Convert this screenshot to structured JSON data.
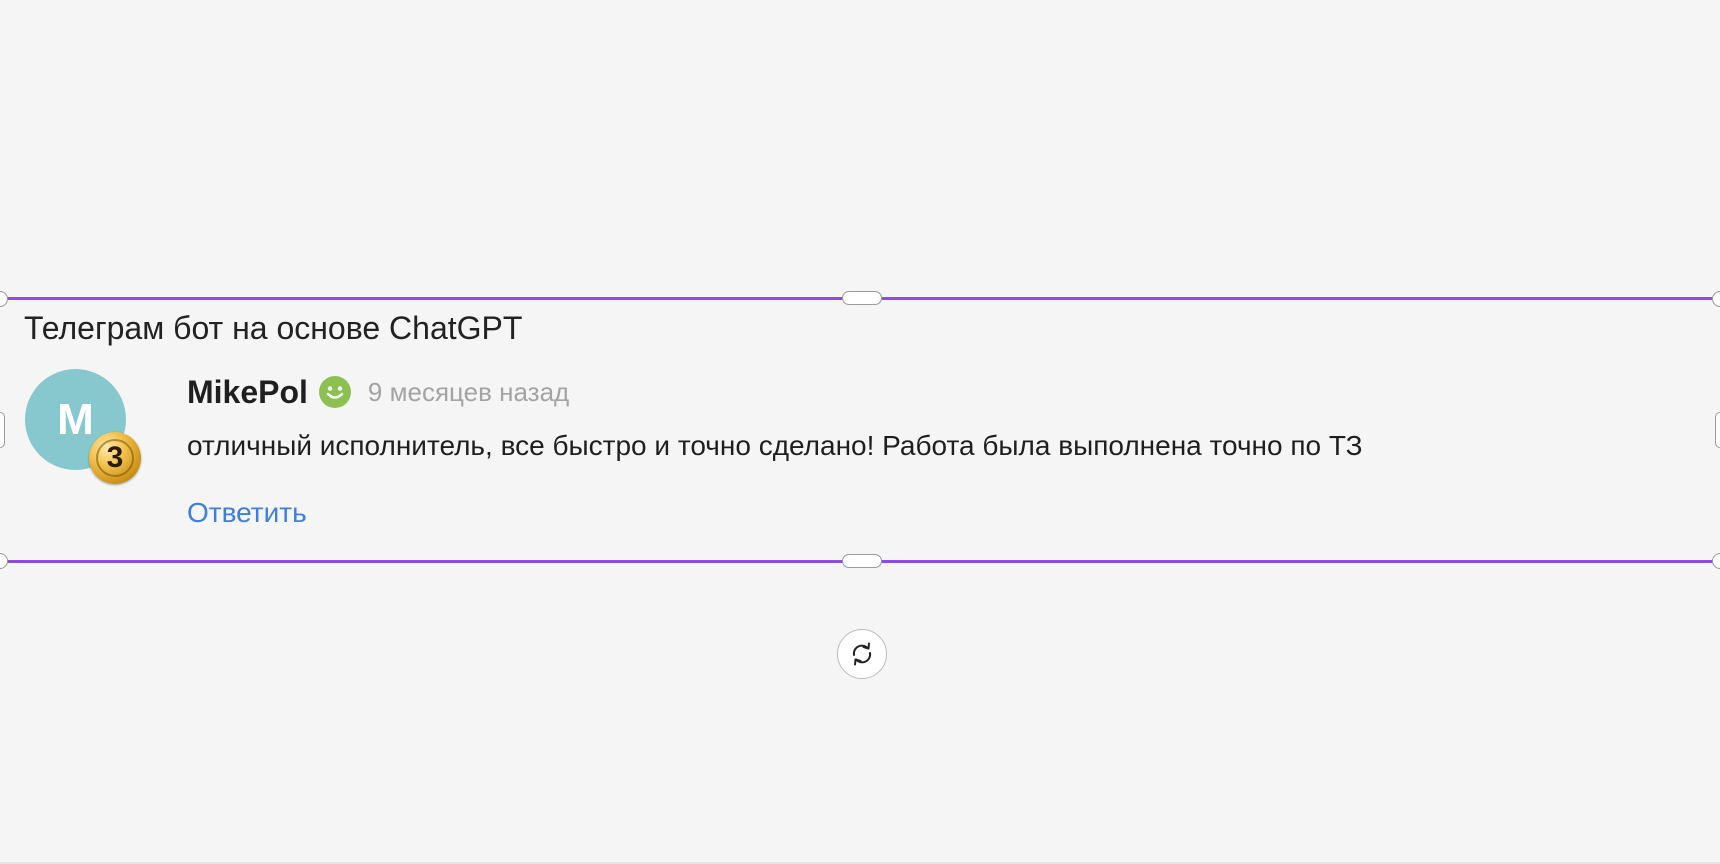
{
  "widget": {
    "title": "Телеграм бот на основе ChatGPT"
  },
  "review": {
    "avatar_initial": "M",
    "avatar_color": "#86c8cd",
    "level_badge": "3",
    "username": "MikePol",
    "status_icon": "smile-icon",
    "time_ago": "9 месяцев назад",
    "text": "отличный исполнитель, все быстро и точно сделано! Работа была выполнена точно по ТЗ",
    "reply_label": "Ответить"
  },
  "selection": {
    "frame_color": "#8a4fe0",
    "rotate_icon": "rotate-icon"
  },
  "colors": {
    "link": "#3d7fe0",
    "muted": "#a3a3a3",
    "status_green": "#8cc152"
  }
}
